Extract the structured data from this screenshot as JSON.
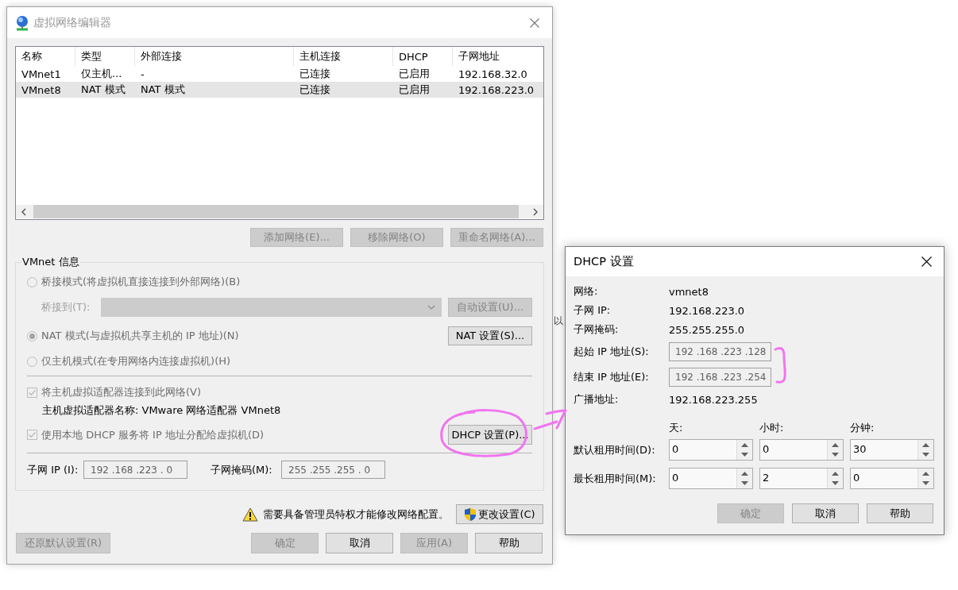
{
  "background_text": "以",
  "main_window": {
    "title": "虚拟网络编辑器",
    "active": false,
    "table": {
      "columns": [
        "名称",
        "类型",
        "外部连接",
        "主机连接",
        "DHCP",
        "子网地址"
      ],
      "rows": [
        {
          "cells": [
            "VMnet1",
            "仅主机...",
            "-",
            "已连接",
            "已启用",
            "192.168.32.0"
          ],
          "selected": false
        },
        {
          "cells": [
            "VMnet8",
            "NAT 模式",
            "NAT 模式",
            "已连接",
            "已启用",
            "192.168.223.0"
          ],
          "selected": true
        }
      ]
    },
    "table_buttons": [
      {
        "label": "添加网络(E)...",
        "disabled": true
      },
      {
        "label": "移除网络(O)",
        "disabled": true
      },
      {
        "label": "重命名网络(A)...",
        "disabled": true
      }
    ],
    "vmnet_info": {
      "title": "VMnet 信息",
      "bridged_mode": {
        "label": "桥接模式(将虚拟机直接连接到外部网络)(B)",
        "selected": false,
        "disabled": true
      },
      "bridge_to": {
        "label": "桥接到(T):",
        "disabled": true
      },
      "bridge_adapter_dropdown": {
        "disabled": true
      },
      "auto_settings_button": {
        "label": "自动设置(U)...",
        "disabled": true
      },
      "nat_mode": {
        "label": "NAT 模式(与虚拟机共享主机的 IP 地址)(N)",
        "selected": true,
        "disabled": true
      },
      "nat_settings_button": {
        "label": "NAT 设置(S)...",
        "disabled": false
      },
      "host_only_mode": {
        "label": "仅主机模式(在专用网络内连接虚拟机)(H)",
        "selected": false,
        "disabled": true
      },
      "connect_host_adapter": {
        "label": "将主机虚拟适配器连接到此网络(V)",
        "checked": true,
        "disabled": true
      },
      "host_adapter_name": "主机虚拟适配器名称: VMware 网络适配器 VMnet8",
      "use_local_dhcp": {
        "label": "使用本地 DHCP 服务将 IP 地址分配给虚拟机(D)",
        "checked": true,
        "disabled": true
      },
      "dhcp_settings_button": {
        "label": "DHCP 设置(P)...",
        "disabled": false
      },
      "subnet_ip": {
        "label": "子网 IP (I):",
        "value": "192 .168 .223 . 0",
        "disabled": true
      },
      "subnet_mask": {
        "label": "子网掩码(M):",
        "value": "255 .255 .255 . 0",
        "disabled": true
      }
    },
    "admin_notice": "需要具备管理员特权才能修改网络配置。",
    "change_settings_button": {
      "label": "更改设置(C)",
      "disabled": false
    },
    "restore_defaults_button": {
      "label": "还原默认设置(R)",
      "disabled": true
    },
    "buttons": [
      {
        "label": "确定",
        "disabled": true
      },
      {
        "label": "取消",
        "disabled": false
      },
      {
        "label": "应用(A)",
        "disabled": true
      },
      {
        "label": "帮助",
        "disabled": false
      }
    ]
  },
  "dhcp_dialog": {
    "title": "DHCP 设置",
    "active": true,
    "rows": [
      {
        "kind": "text",
        "label": "网络:",
        "value": "vmnet8"
      },
      {
        "kind": "text",
        "label": "子网 IP:",
        "value": "192.168.223.0"
      },
      {
        "kind": "text",
        "label": "子网掩码:",
        "value": "255.255.255.0"
      },
      {
        "kind": "field",
        "label": "起始 IP 地址(S):",
        "value": "192 .168 .223 .128",
        "disabled": true
      },
      {
        "kind": "field",
        "label": "结束 IP 地址(E):",
        "value": "192 .168 .223 .254",
        "disabled": true
      },
      {
        "kind": "text",
        "label": "广播地址:",
        "value": "192.168.223.255"
      }
    ],
    "lease_units": [
      "天:",
      "小时:",
      "分钟:"
    ],
    "lease_rows": [
      {
        "label": "默认租用时间(D):",
        "values": [
          "0",
          "0",
          "30"
        ]
      },
      {
        "label": "最长租用时间(M):",
        "values": [
          "0",
          "2",
          "0"
        ]
      }
    ],
    "buttons": [
      {
        "label": "确定",
        "disabled": true
      },
      {
        "label": "取消",
        "disabled": false
      },
      {
        "label": "帮助",
        "disabled": false
      }
    ]
  }
}
